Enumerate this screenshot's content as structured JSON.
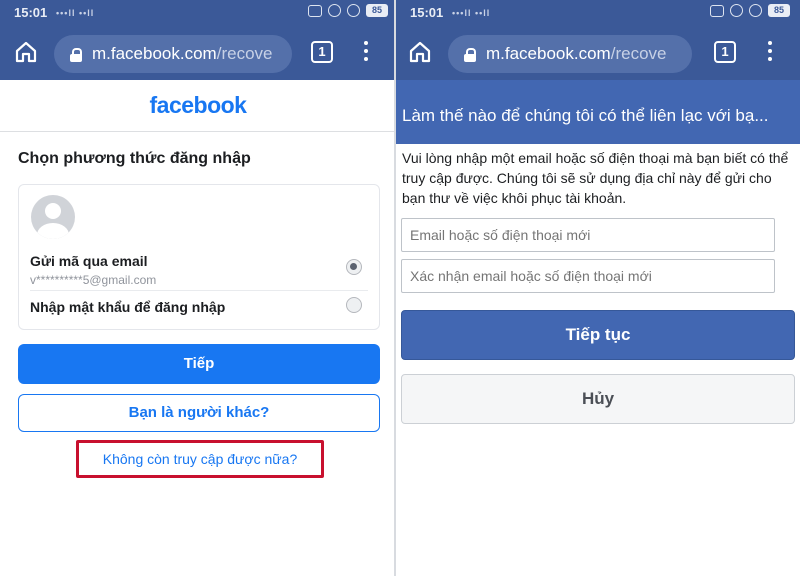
{
  "left": {
    "status": {
      "time": "15:01",
      "signal": "•••ll ••ll",
      "battery": "85"
    },
    "browser": {
      "url_main": "m.facebook.com",
      "url_dim": "/recove",
      "tab_count": "1"
    },
    "logo": "facebook",
    "heading": "Chọn phương thức đăng nhập",
    "option_email_label": "Gửi mã qua email",
    "option_email_address": "v**********5@gmail.com",
    "option_password_label": "Nhập mật khẩu để đăng nhập",
    "next_button": "Tiếp",
    "other_person_button": "Bạn là người khác?",
    "no_access_link": "Không còn truy cập được nữa?"
  },
  "right": {
    "status": {
      "time": "15:01",
      "signal": "•••ll ••ll",
      "battery": "85"
    },
    "browser": {
      "url_main": "m.facebook.com",
      "url_dim": "/recove",
      "tab_count": "1"
    },
    "title": "Làm thế nào để chúng tôi có thể liên lạc với bạ...",
    "description": "Vui lòng nhập một email hoặc số điện thoại mà bạn biết có thể truy cập được. Chúng tôi sẽ sử dụng địa chỉ này để gửi cho bạn thư về việc khôi phục tài khoản.",
    "input_new_placeholder": "Email hoặc số điện thoại mới",
    "input_confirm_placeholder": "Xác nhận email hoặc số điện thoại mới",
    "continue_button": "Tiếp tục",
    "cancel_button": "Hủy"
  },
  "colors": {
    "facebook_blue": "#1877f2",
    "header_blue": "#3b5998",
    "bar_blue": "#4267b2",
    "highlight_red": "#c8102e"
  }
}
